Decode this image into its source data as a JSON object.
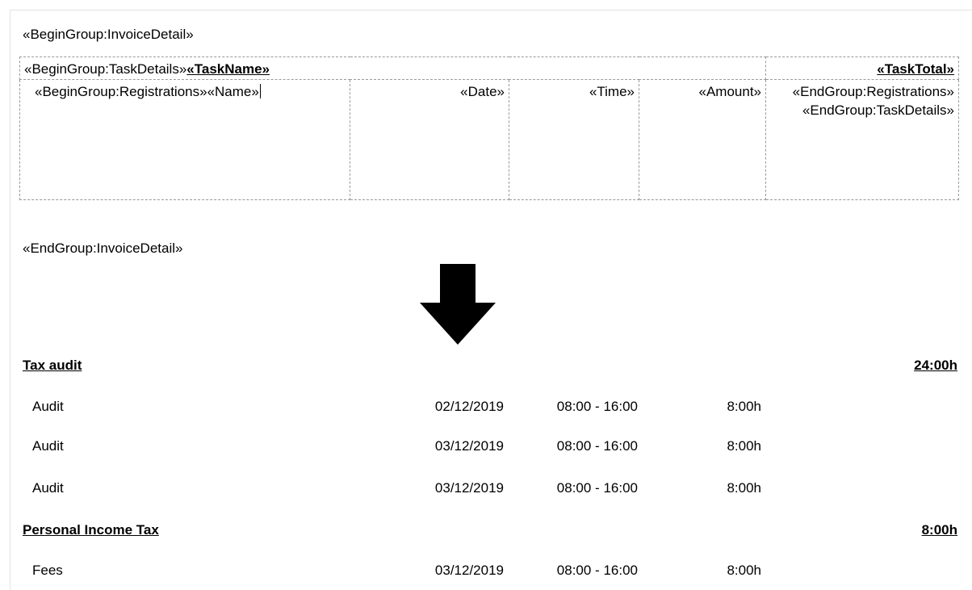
{
  "template": {
    "begin_invoice": "«BeginGroup:InvoiceDetail»",
    "task_details_begin": "«BeginGroup:TaskDetails»",
    "task_name_field": "«TaskName»",
    "task_total_field": "«TaskTotal»",
    "registrations_begin": "«BeginGroup:Registrations»",
    "name_field": "«Name»",
    "date_field": "«Date»",
    "time_field": "«Time»",
    "amount_field": "«Amount»",
    "end_registrations": "«EndGroup:Registrations»",
    "end_task_details": "«EndGroup:TaskDetails»",
    "end_invoice": "«EndGroup:InvoiceDetail»"
  },
  "arrow_icon": "down-arrow-icon",
  "output": {
    "groups": [
      {
        "task_name": "Tax audit",
        "task_total": "24:00h",
        "rows": [
          {
            "name": "Audit",
            "date": "02/12/2019",
            "time": "08:00 - 16:00",
            "amount": "8:00h"
          },
          {
            "name": "Audit",
            "date": "03/12/2019",
            "time": "08:00 - 16:00",
            "amount": "8:00h"
          },
          {
            "name": "Audit",
            "date": "03/12/2019",
            "time": "08:00 - 16:00",
            "amount": "8:00h"
          }
        ]
      },
      {
        "task_name": "Personal Income Tax",
        "task_total": "8:00h",
        "rows": [
          {
            "name": "Fees",
            "date": "03/12/2019",
            "time": "08:00 - 16:00",
            "amount": "8:00h"
          }
        ]
      }
    ]
  }
}
